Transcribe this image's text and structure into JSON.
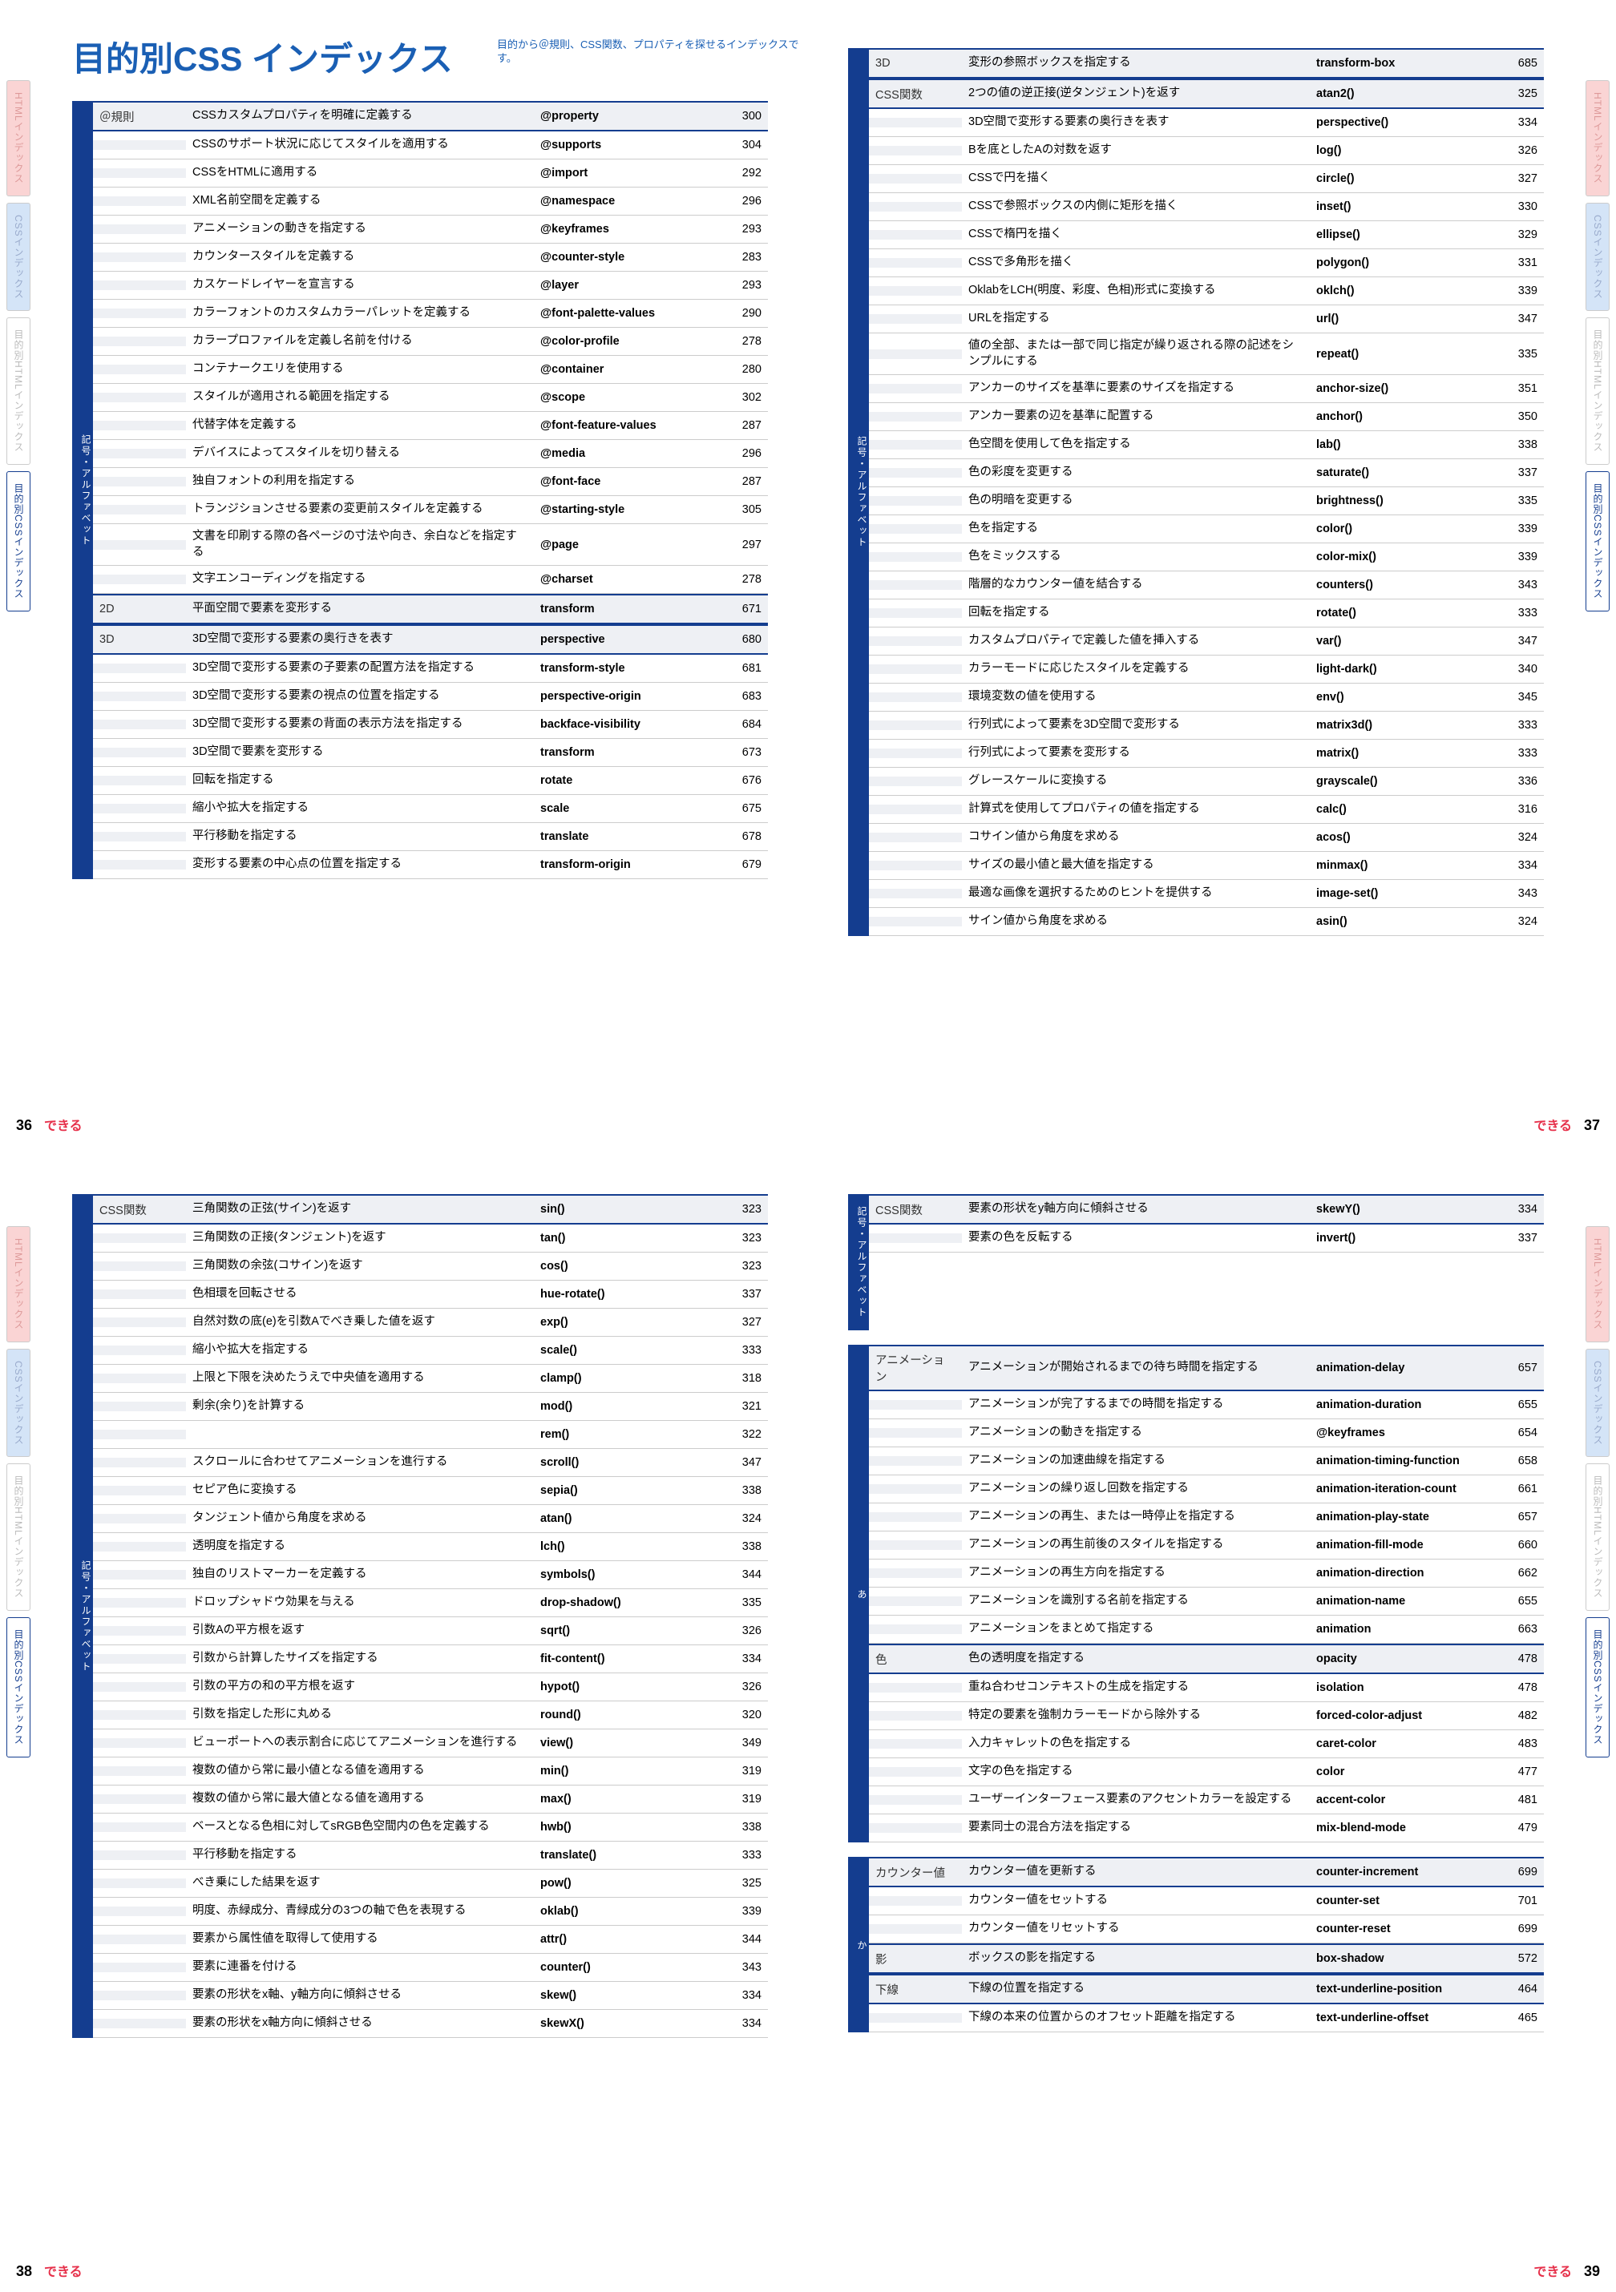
{
  "title": "目的別CSS インデックス",
  "subtitle": "目的から＠規則、CSS関数、プロパティを探せるインデックスです。",
  "dekiru": "できる",
  "vlabel": "記号・アルファベット",
  "vlabel_a": "あ",
  "vlabel_ka": "か",
  "tabs": {
    "html": "HTMLインデックス",
    "css": "CSSインデックス",
    "mhtml": "目的別HTMLインデックス",
    "mcss": "目的別CSSインデックス"
  },
  "pages": {
    "p36": "36",
    "p37": "37",
    "p38": "38",
    "p39": "39"
  },
  "p36": {
    "g1_label": "＠規則",
    "g1": [
      {
        "d": "CSSカスタムプロパティを明確に定義する",
        "p": "@property",
        "n": "300"
      },
      {
        "d": "CSSのサポート状況に応じてスタイルを適用する",
        "p": "@supports",
        "n": "304"
      },
      {
        "d": "CSSをHTMLに適用する",
        "p": "@import",
        "n": "292"
      },
      {
        "d": "XML名前空間を定義する",
        "p": "@namespace",
        "n": "296"
      },
      {
        "d": "アニメーションの動きを指定する",
        "p": "@keyframes",
        "n": "293"
      },
      {
        "d": "カウンタースタイルを定義する",
        "p": "@counter-style",
        "n": "283"
      },
      {
        "d": "カスケードレイヤーを宣言する",
        "p": "@layer",
        "n": "293"
      },
      {
        "d": "カラーフォントのカスタムカラーパレットを定義する",
        "p": "@font-palette-values",
        "n": "290"
      },
      {
        "d": "カラープロファイルを定義し名前を付ける",
        "p": "@color-profile",
        "n": "278"
      },
      {
        "d": "コンテナークエリを使用する",
        "p": "@container",
        "n": "280"
      },
      {
        "d": "スタイルが適用される範囲を指定する",
        "p": "@scope",
        "n": "302"
      },
      {
        "d": "代替字体を定義する",
        "p": "@font-feature-values",
        "n": "287"
      },
      {
        "d": "デバイスによってスタイルを切り替える",
        "p": "@media",
        "n": "296"
      },
      {
        "d": "独自フォントの利用を指定する",
        "p": "@font-face",
        "n": "287"
      },
      {
        "d": "トランジションさせる要素の変更前スタイルを定義する",
        "p": "@starting-style",
        "n": "305"
      },
      {
        "d": "文書を印刷する際の各ページの寸法や向き、余白などを指定する",
        "p": "@page",
        "n": "297"
      },
      {
        "d": "文字エンコーディングを指定する",
        "p": "@charset",
        "n": "278"
      }
    ],
    "g2_label": "2D",
    "g2": [
      {
        "d": "平面空間で要素を変形する",
        "p": "transform",
        "n": "671"
      }
    ],
    "g3_label": "3D",
    "g3": [
      {
        "d": "3D空間で変形する要素の奥行きを表す",
        "p": "perspective",
        "n": "680"
      },
      {
        "d": "3D空間で変形する要素の子要素の配置方法を指定する",
        "p": "transform-style",
        "n": "681"
      },
      {
        "d": "3D空間で変形する要素の視点の位置を指定する",
        "p": "perspective-origin",
        "n": "683"
      },
      {
        "d": "3D空間で変形する要素の背面の表示方法を指定する",
        "p": "backface-visibility",
        "n": "684"
      },
      {
        "d": "3D空間で要素を変形する",
        "p": "transform",
        "n": "673"
      },
      {
        "d": "回転を指定する",
        "p": "rotate",
        "n": "676"
      },
      {
        "d": "縮小や拡大を指定する",
        "p": "scale",
        "n": "675"
      },
      {
        "d": "平行移動を指定する",
        "p": "translate",
        "n": "678"
      },
      {
        "d": "変形する要素の中心点の位置を指定する",
        "p": "transform-origin",
        "n": "679"
      }
    ]
  },
  "p37": {
    "g1_label": "3D",
    "g1": [
      {
        "d": "変形の参照ボックスを指定する",
        "p": "transform-box",
        "n": "685"
      }
    ],
    "g2_label": "CSS関数",
    "g2": [
      {
        "d": "2つの値の逆正接(逆タンジェント)を返す",
        "p": "atan2()",
        "n": "325"
      },
      {
        "d": "3D空間で変形する要素の奥行きを表す",
        "p": "perspective()",
        "n": "334"
      },
      {
        "d": "Bを底としたAの対数を返す",
        "p": "log()",
        "n": "326"
      },
      {
        "d": "CSSで円を描く",
        "p": "circle()",
        "n": "327"
      },
      {
        "d": "CSSで参照ボックスの内側に矩形を描く",
        "p": "inset()",
        "n": "330"
      },
      {
        "d": "CSSで楕円を描く",
        "p": "ellipse()",
        "n": "329"
      },
      {
        "d": "CSSで多角形を描く",
        "p": "polygon()",
        "n": "331"
      },
      {
        "d": "OklabをLCH(明度、彩度、色相)形式に変換する",
        "p": "oklch()",
        "n": "339"
      },
      {
        "d": "URLを指定する",
        "p": "url()",
        "n": "347"
      },
      {
        "d": "値の全部、または一部で同じ指定が繰り返される際の記述をシンプルにする",
        "p": "repeat()",
        "n": "335"
      },
      {
        "d": "アンカーのサイズを基準に要素のサイズを指定する",
        "p": "anchor-size()",
        "n": "351"
      },
      {
        "d": "アンカー要素の辺を基準に配置する",
        "p": "anchor()",
        "n": "350"
      },
      {
        "d": "色空間を使用して色を指定する",
        "p": "lab()",
        "n": "338"
      },
      {
        "d": "色の彩度を変更する",
        "p": "saturate()",
        "n": "337"
      },
      {
        "d": "色の明暗を変更する",
        "p": "brightness()",
        "n": "335"
      },
      {
        "d": "色を指定する",
        "p": "color()",
        "n": "339"
      },
      {
        "d": "色をミックスする",
        "p": "color-mix()",
        "n": "339"
      },
      {
        "d": "階層的なカウンター値を結合する",
        "p": "counters()",
        "n": "343"
      },
      {
        "d": "回転を指定する",
        "p": "rotate()",
        "n": "333"
      },
      {
        "d": "カスタムプロパティで定義した値を挿入する",
        "p": "var()",
        "n": "347"
      },
      {
        "d": "カラーモードに応じたスタイルを定義する",
        "p": "light-dark()",
        "n": "340"
      },
      {
        "d": "環境変数の値を使用する",
        "p": "env()",
        "n": "345"
      },
      {
        "d": "行列式によって要素を3D空間で変形する",
        "p": "matrix3d()",
        "n": "333"
      },
      {
        "d": "行列式によって要素を変形する",
        "p": "matrix()",
        "n": "333"
      },
      {
        "d": "グレースケールに変換する",
        "p": "grayscale()",
        "n": "336"
      },
      {
        "d": "計算式を使用してプロパティの値を指定する",
        "p": "calc()",
        "n": "316"
      },
      {
        "d": "コサイン値から角度を求める",
        "p": "acos()",
        "n": "324"
      },
      {
        "d": "サイズの最小値と最大値を指定する",
        "p": "minmax()",
        "n": "334"
      },
      {
        "d": "最適な画像を選択するためのヒントを提供する",
        "p": "image-set()",
        "n": "343"
      },
      {
        "d": "サイン値から角度を求める",
        "p": "asin()",
        "n": "324"
      }
    ]
  },
  "p38": {
    "g1_label": "CSS関数",
    "g1": [
      {
        "d": "三角関数の正弦(サイン)を返す",
        "p": "sin()",
        "n": "323"
      },
      {
        "d": "三角関数の正接(タンジェント)を返す",
        "p": "tan()",
        "n": "323"
      },
      {
        "d": "三角関数の余弦(コサイン)を返す",
        "p": "cos()",
        "n": "323"
      },
      {
        "d": "色相環を回転させる",
        "p": "hue-rotate()",
        "n": "337"
      },
      {
        "d": "自然対数の底(e)を引数Aでべき乗した値を返す",
        "p": "exp()",
        "n": "327"
      },
      {
        "d": "縮小や拡大を指定する",
        "p": "scale()",
        "n": "333"
      },
      {
        "d": "上限と下限を決めたうえで中央値を適用する",
        "p": "clamp()",
        "n": "318"
      },
      {
        "d": "剰余(余り)を計算する",
        "p": "mod()",
        "n": "321"
      },
      {
        "d": "",
        "p": "rem()",
        "n": "322"
      },
      {
        "d": "スクロールに合わせてアニメーションを進行する",
        "p": "scroll()",
        "n": "347"
      },
      {
        "d": "セピア色に変換する",
        "p": "sepia()",
        "n": "338"
      },
      {
        "d": "タンジェント値から角度を求める",
        "p": "atan()",
        "n": "324"
      },
      {
        "d": "透明度を指定する",
        "p": "lch()",
        "n": "338"
      },
      {
        "d": "独自のリストマーカーを定義する",
        "p": "symbols()",
        "n": "344"
      },
      {
        "d": "ドロップシャドウ効果を与える",
        "p": "drop-shadow()",
        "n": "335"
      },
      {
        "d": "引数Aの平方根を返す",
        "p": "sqrt()",
        "n": "326"
      },
      {
        "d": "引数から計算したサイズを指定する",
        "p": "fit-content()",
        "n": "334"
      },
      {
        "d": "引数の平方の和の平方根を返す",
        "p": "hypot()",
        "n": "326"
      },
      {
        "d": "引数を指定した形に丸める",
        "p": "round()",
        "n": "320"
      },
      {
        "d": "ビューポートへの表示割合に応じてアニメーションを進行する",
        "p": "view()",
        "n": "349"
      },
      {
        "d": "複数の値から常に最小値となる値を適用する",
        "p": "min()",
        "n": "319"
      },
      {
        "d": "複数の値から常に最大値となる値を適用する",
        "p": "max()",
        "n": "319"
      },
      {
        "d": "ベースとなる色相に対してsRGB色空間内の色を定義する",
        "p": "hwb()",
        "n": "338"
      },
      {
        "d": "平行移動を指定する",
        "p": "translate()",
        "n": "333"
      },
      {
        "d": "べき乗にした結果を返す",
        "p": "pow()",
        "n": "325"
      },
      {
        "d": "明度、赤緑成分、青緑成分の3つの軸で色を表現する",
        "p": "oklab()",
        "n": "339"
      },
      {
        "d": "要素から属性値を取得して使用する",
        "p": "attr()",
        "n": "344"
      },
      {
        "d": "要素に連番を付ける",
        "p": "counter()",
        "n": "343"
      },
      {
        "d": "要素の形状をx軸、y軸方向に傾斜させる",
        "p": "skew()",
        "n": "334"
      },
      {
        "d": "要素の形状をx軸方向に傾斜させる",
        "p": "skewX()",
        "n": "334"
      }
    ]
  },
  "p39": {
    "g1_label": "CSS関数",
    "g1": [
      {
        "d": "要素の形状をy軸方向に傾斜させる",
        "p": "skewY()",
        "n": "334"
      },
      {
        "d": "要素の色を反転する",
        "p": "invert()",
        "n": "337"
      }
    ],
    "g2_label": "アニメーション",
    "g2": [
      {
        "d": "アニメーションが開始されるまでの待ち時間を指定する",
        "p": "animation-delay",
        "n": "657"
      },
      {
        "d": "アニメーションが完了するまでの時間を指定する",
        "p": "animation-duration",
        "n": "655"
      },
      {
        "d": "アニメーションの動きを指定する",
        "p": "@keyframes",
        "n": "654"
      },
      {
        "d": "アニメーションの加速曲線を指定する",
        "p": "animation-timing-function",
        "n": "658"
      },
      {
        "d": "アニメーションの繰り返し回数を指定する",
        "p": "animation-iteration-count",
        "n": "661"
      },
      {
        "d": "アニメーションの再生、または一時停止を指定する",
        "p": "animation-play-state",
        "n": "657"
      },
      {
        "d": "アニメーションの再生前後のスタイルを指定する",
        "p": "animation-fill-mode",
        "n": "660"
      },
      {
        "d": "アニメーションの再生方向を指定する",
        "p": "animation-direction",
        "n": "662"
      },
      {
        "d": "アニメーションを識別する名前を指定する",
        "p": "animation-name",
        "n": "655"
      },
      {
        "d": "アニメーションをまとめて指定する",
        "p": "animation",
        "n": "663"
      }
    ],
    "g3_label": "色",
    "g3": [
      {
        "d": "色の透明度を指定する",
        "p": "opacity",
        "n": "478"
      },
      {
        "d": "重ね合わせコンテキストの生成を指定する",
        "p": "isolation",
        "n": "478"
      },
      {
        "d": "特定の要素を強制カラーモードから除外する",
        "p": "forced-color-adjust",
        "n": "482"
      },
      {
        "d": "入力キャレットの色を指定する",
        "p": "caret-color",
        "n": "483"
      },
      {
        "d": "文字の色を指定する",
        "p": "color",
        "n": "477"
      },
      {
        "d": "ユーザーインターフェース要素のアクセントカラーを設定する",
        "p": "accent-color",
        "n": "481"
      },
      {
        "d": "要素同士の混合方法を指定する",
        "p": "mix-blend-mode",
        "n": "479"
      }
    ],
    "g4_label": "カウンター値",
    "g4": [
      {
        "d": "カウンター値を更新する",
        "p": "counter-increment",
        "n": "699"
      },
      {
        "d": "カウンター値をセットする",
        "p": "counter-set",
        "n": "701"
      },
      {
        "d": "カウンター値をリセットする",
        "p": "counter-reset",
        "n": "699"
      }
    ],
    "g5_label": "影",
    "g5": [
      {
        "d": "ボックスの影を指定する",
        "p": "box-shadow",
        "n": "572"
      }
    ],
    "g6_label": "下線",
    "g6": [
      {
        "d": "下線の位置を指定する",
        "p": "text-underline-position",
        "n": "464"
      },
      {
        "d": "下線の本来の位置からのオフセット距離を指定する",
        "p": "text-underline-offset",
        "n": "465"
      }
    ]
  }
}
